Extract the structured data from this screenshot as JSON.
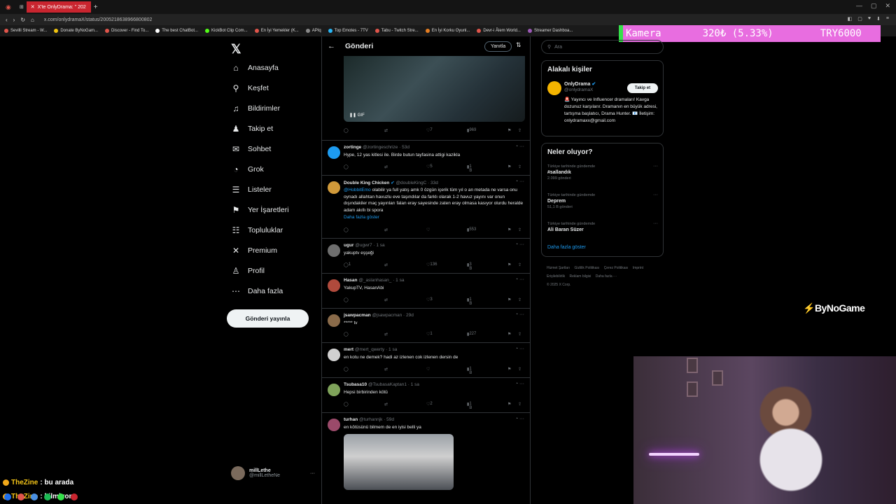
{
  "browser": {
    "tab_label": "X'te OnlyDrama: \" 202",
    "url": "x.com/onlydramaX/status/2005218638966800802",
    "bookmarks": [
      "Sevilli Stream - W...",
      "Donate ByNoGam...",
      "Discover - Find To...",
      "The best ChatBot...",
      "KickBot Clip Com...",
      "En İyi Yemekler (K...",
      "APIq",
      "Top Emotes - 7TV",
      "Tabu - Twitch Stre...",
      "En İyi Korku Oyunl...",
      "Devr-i Âlem World...",
      "Streamer Dashboa..."
    ]
  },
  "overlay": {
    "label": "Kamera",
    "price": "320₺ (5.33%)",
    "goal": "TRY6000",
    "bg_color": "#e86de0"
  },
  "nav": {
    "items": [
      {
        "label": "Anasayfa",
        "icon": "home-icon"
      },
      {
        "label": "Keşfet",
        "icon": "search-icon"
      },
      {
        "label": "Bildirimler",
        "icon": "bell-icon"
      },
      {
        "label": "Takip et",
        "icon": "follow-icon"
      },
      {
        "label": "Sohbet",
        "icon": "mail-icon"
      },
      {
        "label": "Grok",
        "icon": "grok-icon"
      },
      {
        "label": "Listeler",
        "icon": "list-icon"
      },
      {
        "label": "Yer İşaretleri",
        "icon": "bookmark-icon"
      },
      {
        "label": "Topluluklar",
        "icon": "communities-icon"
      },
      {
        "label": "Premium",
        "icon": "x-icon"
      },
      {
        "label": "Profil",
        "icon": "profile-icon"
      },
      {
        "label": "Daha fazla",
        "icon": "more-icon"
      }
    ],
    "post_button": "Gönderi yayınla",
    "user_name": "millLethe",
    "user_handle": "@millLetheNe"
  },
  "main": {
    "title": "Gönderi",
    "reply_button": "Yanıtla",
    "first_actions": {
      "likes": "7",
      "views": "969"
    },
    "gif_label": "GIF",
    "tweets": [
      {
        "name": "zortinge",
        "meta": "@zortingeschrize · 53d",
        "text": "Hype, 12 yas kitlesi ile. Birde butun tayfasina attigi kazikla",
        "likes": "5",
        "views": "1 B",
        "avatar_color": "#1d9bf0"
      },
      {
        "name": "Double King Chicken",
        "meta": "@doubleKingC · 33d",
        "mention": "@HobbitEmo",
        "text": "olabilir ya full yatış amk 0 özgün içerik tüm yıl o an metada ne varsa onu oynadı allahtan havuzlu eve taşındılar da farklı olarak 1-2 havuz yayını var onun dışındakiler maç yayınları falan eray sayesinde zaten eray olmasa kasıyor olurdu heralde adam akıllı bi spora",
        "show_more": "Daha fazla göster",
        "views": "553",
        "avatar_color": "#d19a3a"
      },
      {
        "name": "ugur",
        "meta": "@ugwr7 · 1 sa",
        "text": "yakuptv eşşeği",
        "replies": "1",
        "likes": "136",
        "views": "3 B",
        "avatar_color": "#6e6e6e"
      },
      {
        "name": "Hasan",
        "meta": "@_aslanhasan_ · 1 sa",
        "text": "YakupTV, HasanAbi",
        "likes": "3",
        "views": "1 B",
        "avatar_color": "#b04a3c"
      },
      {
        "name": "jsawpacman",
        "meta": "@jsawpacman · 29d",
        "text": "***** tv",
        "likes": "1",
        "views": "227",
        "avatar_color": "#8a6b4a"
      },
      {
        "name": "mert",
        "meta": "@mert_qwerty · 1 sa",
        "text": "en kotu ne demek? hadi az izlenen cok izlenen dersin de",
        "views": "1 B",
        "avatar_color": "#d0d0d0"
      },
      {
        "name": "Tsubasa10",
        "meta": "@TsubasaKaptan1 · 1 sa",
        "text": "Hepsi birbirinden kötü",
        "likes": "2",
        "views": "1 B",
        "avatar_color": "#7fa35a"
      },
      {
        "name": "turhan",
        "meta": "@turhannjk · 59d",
        "text": "en kötüsünü bilmem de en iyisi belli ya",
        "avatar_color": "#9b4a6a"
      }
    ]
  },
  "right": {
    "search_placeholder": "Ara",
    "people_title": "Alakalı kişiler",
    "person_name": "OnlyDrama",
    "person_handle": "@onlydramaX",
    "follow_label": "Takip et",
    "person_bio": "🚨 Yayıncı ve Influencer dramaları! Kavga dozunuz karşılarır. Dramanın en büyük adresi, tartışma başlatıcı, Drama Hunter. 📧 İletişim: onlydramaxx@gmail.com",
    "trends_title": "Neler oluyor?",
    "trends": [
      {
        "context": "Türkiye tarihinde gündemde",
        "title": "#sallandık",
        "count": "2.099 gönderi"
      },
      {
        "context": "Türkiye tarihinde gündemde",
        "title": "Deprem",
        "count": "51,1 B gönderi"
      },
      {
        "context": "Türkiye tarihinde gündemde",
        "title": "Ali Baran Süzer",
        "count": ""
      }
    ],
    "show_more": "Daha fazla göster",
    "footer": [
      "Hizmet Şartları",
      "Gizlilik Politikası",
      "Çerez Politikası",
      "Imprint",
      "Erişilebilirlik",
      "Reklam bilgisi",
      "Daha fazla ···",
      "© 2025 X Corp."
    ]
  },
  "watermark": "ByNoGame",
  "chat": [
    {
      "user": "TheZine",
      "text": ": bu arada"
    },
    {
      "user": "TheZine",
      "text": ": bilmiyom"
    }
  ]
}
